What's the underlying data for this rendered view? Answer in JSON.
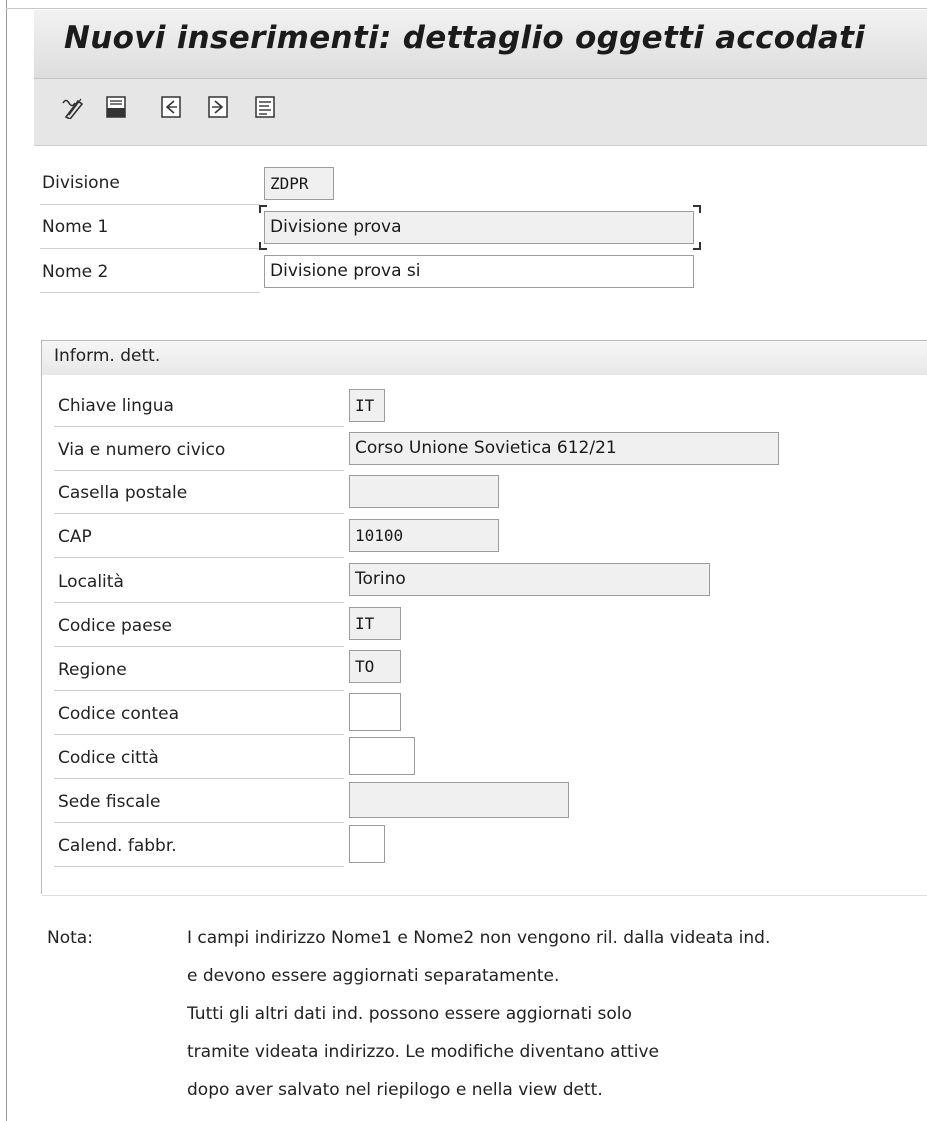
{
  "window": {
    "title": "Nuovi inserimenti: dettaglio oggetti accodati"
  },
  "toolbar": {
    "icons": [
      "change-display-icon",
      "save-icon",
      "previous-entry-icon",
      "next-entry-icon",
      "details-list-icon"
    ]
  },
  "header_fields": {
    "divisione": {
      "label": "Divisione",
      "value": "ZDPR"
    },
    "nome1": {
      "label": "Nome 1",
      "value": "Divisione prova"
    },
    "nome2": {
      "label": "Nome 2",
      "value": "Divisione prova si"
    }
  },
  "details_group": {
    "title": "Inform. dett.",
    "fields": {
      "chiave_lingua": {
        "label": "Chiave lingua",
        "value": "IT"
      },
      "via": {
        "label": "Via e numero civico",
        "value": "Corso Unione Sovietica 612/21"
      },
      "casella_postale": {
        "label": "Casella postale",
        "value": ""
      },
      "cap": {
        "label": "CAP",
        "value": "10100"
      },
      "localita": {
        "label": "Località",
        "value": "Torino"
      },
      "codice_paese": {
        "label": "Codice paese",
        "value": "IT"
      },
      "regione": {
        "label": "Regione",
        "value": "TO"
      },
      "codice_contea": {
        "label": "Codice contea",
        "value": ""
      },
      "codice_citta": {
        "label": "Codice città",
        "value": ""
      },
      "sede_fiscale": {
        "label": "Sede fiscale",
        "value": ""
      },
      "calend_fabbr": {
        "label": "Calend. fabbr.",
        "value": ""
      }
    }
  },
  "note": {
    "label": "Nota:",
    "lines": [
      "I campi indirizzo Nome1 e Nome2 non vengono ril. dalla videata ind.",
      "e devono essere aggiornati separatamente.",
      "Tutti gli altri dati ind. possono essere aggiornati solo",
      "tramite videata indirizzo. Le modifiche diventano attive",
      "dopo aver salvato nel riepilogo e nella view dett."
    ]
  },
  "colors": {
    "title_bg": "#e4e4e4",
    "readonly_field_bg": "#f0f0f0",
    "editable_field_bg": "#ffffff"
  }
}
